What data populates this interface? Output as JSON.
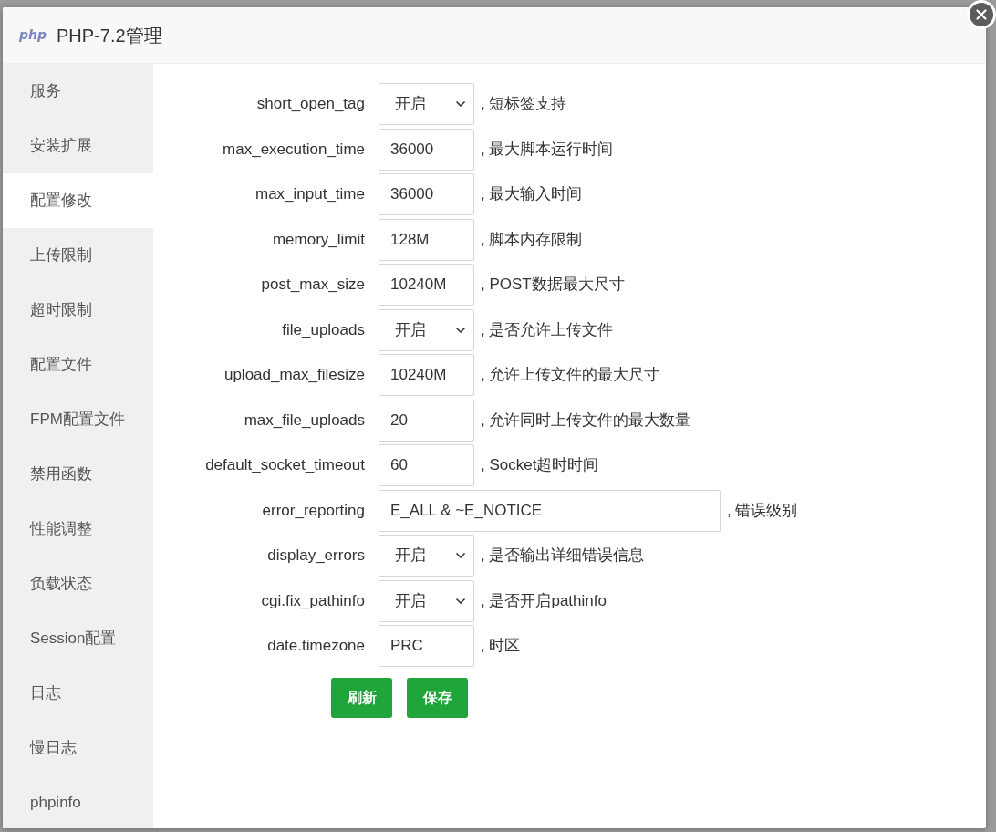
{
  "window": {
    "logo_text": "php",
    "title": "PHP-7.2管理"
  },
  "sidebar": {
    "items": [
      {
        "label": "服务",
        "selected": false
      },
      {
        "label": "安装扩展",
        "selected": false
      },
      {
        "label": "配置修改",
        "selected": true
      },
      {
        "label": "上传限制",
        "selected": false
      },
      {
        "label": "超时限制",
        "selected": false
      },
      {
        "label": "配置文件",
        "selected": false
      },
      {
        "label": "FPM配置文件",
        "selected": false
      },
      {
        "label": "禁用函数",
        "selected": false
      },
      {
        "label": "性能调整",
        "selected": false
      },
      {
        "label": "负载状态",
        "selected": false
      },
      {
        "label": "Session配置",
        "selected": false
      },
      {
        "label": "日志",
        "selected": false
      },
      {
        "label": "慢日志",
        "selected": false
      },
      {
        "label": "phpinfo",
        "selected": false
      }
    ]
  },
  "form": {
    "rows": [
      {
        "kind": "select",
        "label": "short_open_tag",
        "value": "开启",
        "description": ", 短标签支持"
      },
      {
        "kind": "input",
        "label": "max_execution_time",
        "value": "36000",
        "description": ", 最大脚本运行时间"
      },
      {
        "kind": "input",
        "label": "max_input_time",
        "value": "36000",
        "description": ", 最大输入时间"
      },
      {
        "kind": "input",
        "label": "memory_limit",
        "value": "128M",
        "description": ", 脚本内存限制"
      },
      {
        "kind": "input",
        "label": "post_max_size",
        "value": "10240M",
        "description": ", POST数据最大尺寸"
      },
      {
        "kind": "select",
        "label": "file_uploads",
        "value": "开启",
        "description": ", 是否允许上传文件"
      },
      {
        "kind": "input",
        "label": "upload_max_filesize",
        "value": "10240M",
        "description": ", 允许上传文件的最大尺寸"
      },
      {
        "kind": "input",
        "label": "max_file_uploads",
        "value": "20",
        "description": ", 允许同时上传文件的最大数量"
      },
      {
        "kind": "input",
        "label": "default_socket_timeout",
        "value": "60",
        "description": ", Socket超时时间"
      },
      {
        "kind": "wide_input",
        "label": "error_reporting",
        "value": "E_ALL & ~E_NOTICE",
        "description": ", 错误级别"
      },
      {
        "kind": "select",
        "label": "display_errors",
        "value": "开启",
        "description": ", 是否输出详细错误信息"
      },
      {
        "kind": "select",
        "label": "cgi.fix_pathinfo",
        "value": "开启",
        "description": ", 是否开启pathinfo"
      },
      {
        "kind": "input",
        "label": "date.timezone",
        "value": "PRC",
        "description": ", 时区"
      }
    ],
    "buttons": [
      {
        "label": "刷新"
      },
      {
        "label": "保存"
      }
    ]
  }
}
